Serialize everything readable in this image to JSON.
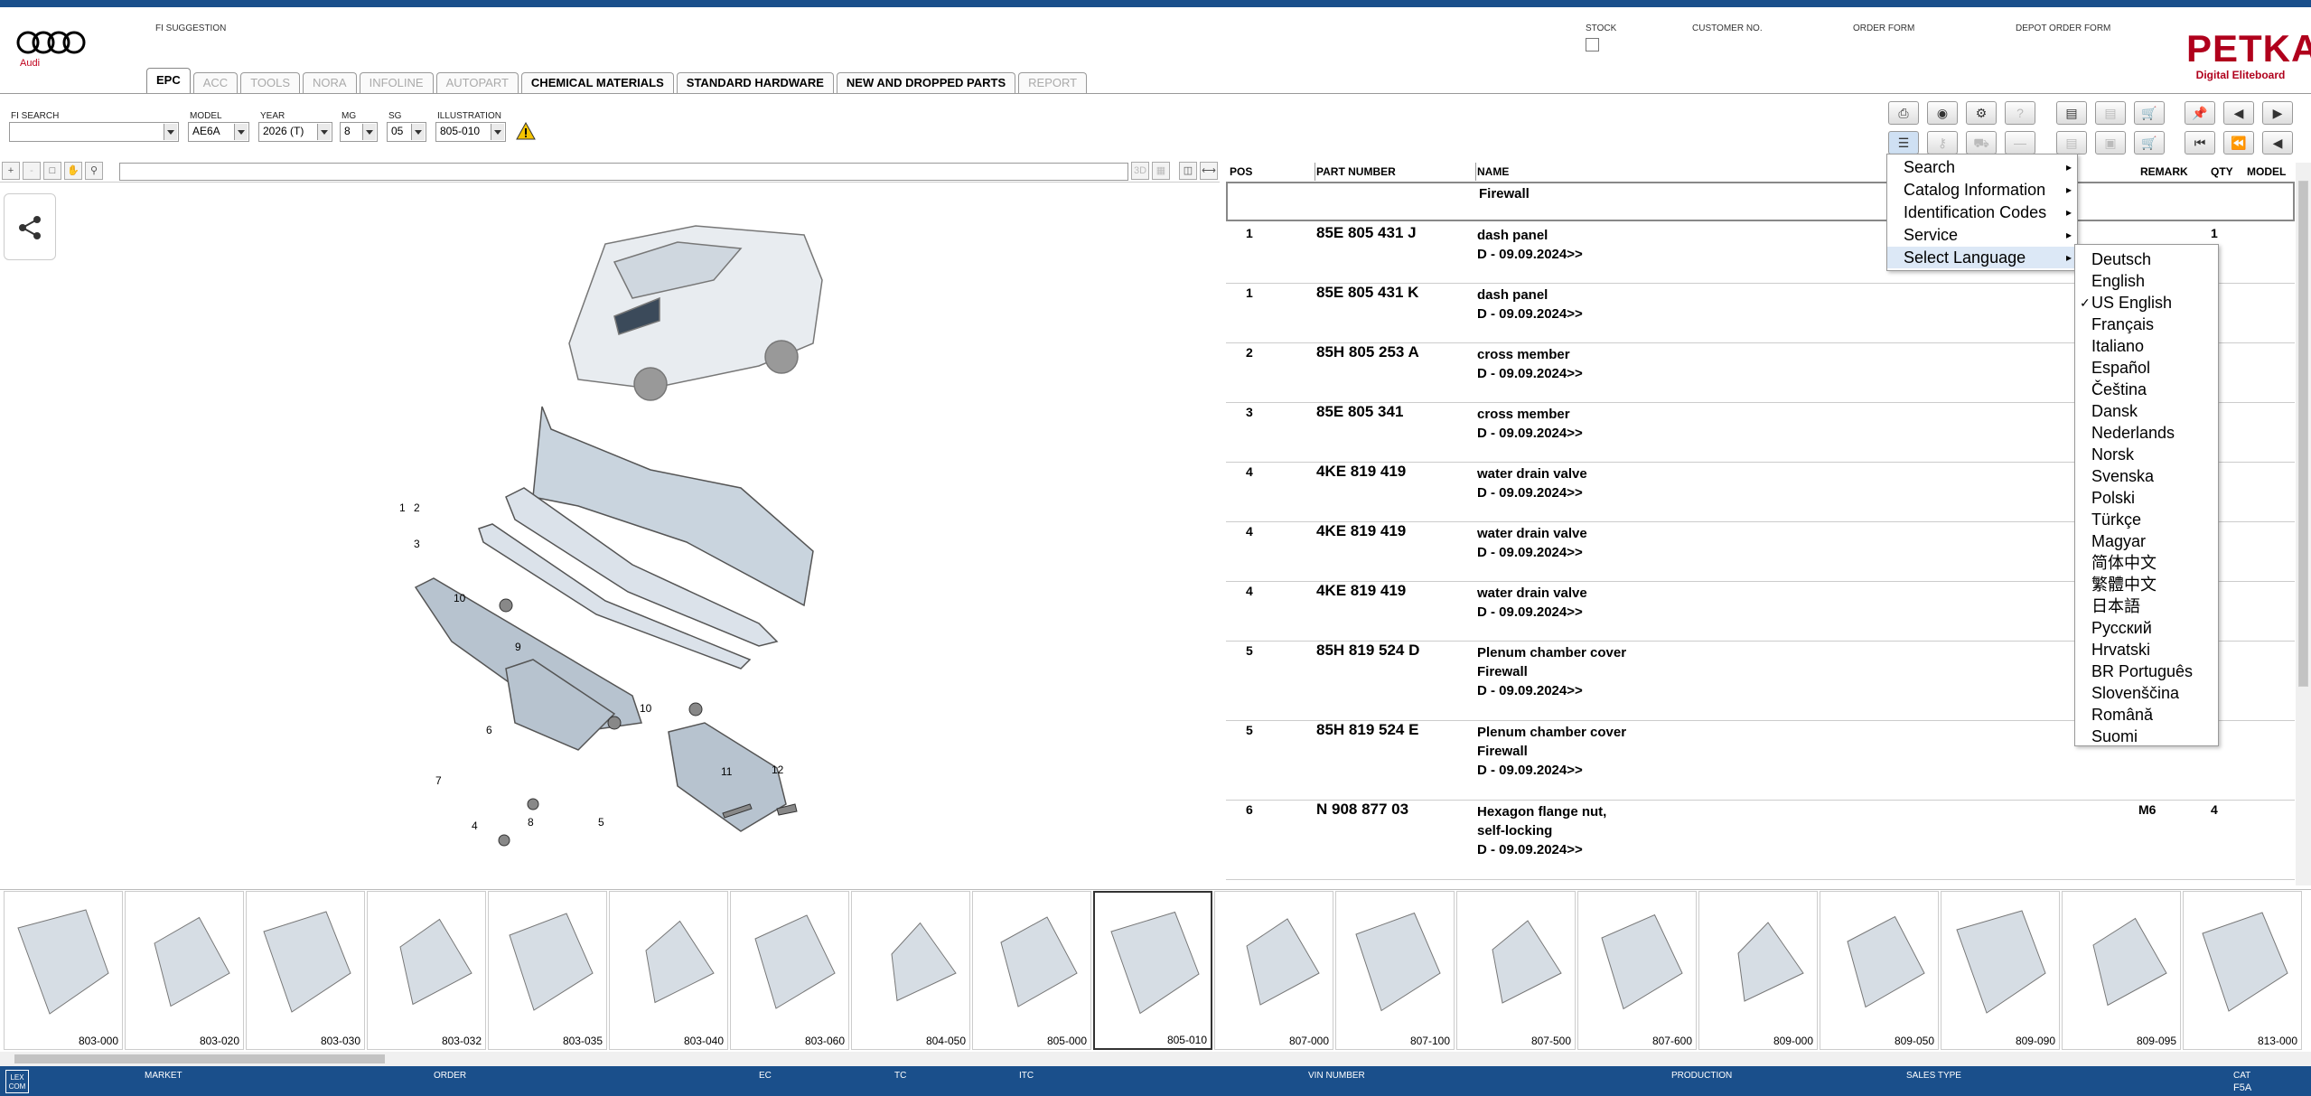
{
  "header": {
    "fi_suggestion": "FI SUGGESTION",
    "brand": "Audi",
    "stock": "STOCK",
    "customer_no": "CUSTOMER NO.",
    "order_form": "ORDER FORM",
    "depot_order_form": "DEPOT ORDER FORM",
    "petka_title": "PETKA",
    "petka_sub": "Digital Eliteboard"
  },
  "tabs": [
    {
      "label": "EPC",
      "state": "active"
    },
    {
      "label": "ACC",
      "state": "disabled"
    },
    {
      "label": "TOOLS",
      "state": "disabled"
    },
    {
      "label": "NORA",
      "state": "disabled"
    },
    {
      "label": "INFOLINE",
      "state": "disabled"
    },
    {
      "label": "AUTOPART",
      "state": "disabled"
    },
    {
      "label": "CHEMICAL MATERIALS",
      "state": "enabled"
    },
    {
      "label": "STANDARD HARDWARE",
      "state": "enabled"
    },
    {
      "label": "NEW AND DROPPED PARTS",
      "state": "enabled"
    },
    {
      "label": "REPORT",
      "state": "disabled"
    }
  ],
  "filters": {
    "fi_search_label": "FI SEARCH",
    "fi_search_value": "",
    "model_label": "MODEL",
    "model_value": "AE6A",
    "year_label": "YEAR",
    "year_value": "2026 (T)",
    "mg_label": "MG",
    "mg_value": "8",
    "sg_label": "SG",
    "sg_value": "05",
    "illustration_label": "ILLUSTRATION",
    "illustration_value": "805-010"
  },
  "table": {
    "headers": {
      "pos": "POS",
      "part_number": "PART NUMBER",
      "name": "NAME",
      "remark": "REMARK",
      "qty": "QTY",
      "model": "MODEL"
    },
    "first_row_name": "Firewall",
    "rows": [
      {
        "pos": "1",
        "part": "85E 805 431 J",
        "name": [
          "dash panel",
          "D - 09.09.2024>>"
        ],
        "remark": "",
        "qty": "1"
      },
      {
        "pos": "1",
        "part": "85E 805 431 K",
        "name": [
          "dash panel",
          "D - 09.09.2024>>"
        ],
        "remark": "",
        "qty": ""
      },
      {
        "pos": "2",
        "part": "85H 805 253 A",
        "name": [
          "cross member",
          "D - 09.09.2024>>"
        ],
        "remark": "",
        "qty": ""
      },
      {
        "pos": "3",
        "part": "85E 805 341",
        "name": [
          "cross member",
          "D - 09.09.2024>>"
        ],
        "remark": "",
        "qty": ""
      },
      {
        "pos": "4",
        "part": "4KE 819 419",
        "name": [
          "water drain valve",
          "D - 09.09.2024>>"
        ],
        "remark": "",
        "qty": ""
      },
      {
        "pos": "4",
        "part": "4KE 819 419",
        "name": [
          "water drain valve",
          "D - 09.09.2024>>"
        ],
        "remark": "",
        "qty": ""
      },
      {
        "pos": "4",
        "part": "4KE 819 419",
        "name": [
          "water drain valve",
          "D - 09.09.2024>>"
        ],
        "remark": "",
        "qty": ""
      },
      {
        "pos": "5",
        "part": "85H 819 524 D",
        "name": [
          "Plenum chamber cover",
          "Firewall",
          "D - 09.09.2024>>"
        ],
        "remark": "",
        "qty": ""
      },
      {
        "pos": "5",
        "part": "85H 819 524 E",
        "name": [
          "Plenum chamber cover",
          "Firewall",
          "D - 09.09.2024>>"
        ],
        "remark": "",
        "qty": ""
      },
      {
        "pos": "6",
        "part": "N   908 877 03",
        "name": [
          "Hexagon flange nut,",
          "self-locking",
          "D - 09.09.2024>>"
        ],
        "remark": "M6",
        "qty": "4"
      }
    ]
  },
  "context_menu": {
    "items": [
      {
        "label": "Search",
        "highlight": false
      },
      {
        "label": "Catalog Information",
        "highlight": false
      },
      {
        "label": "Identification Codes",
        "highlight": false
      },
      {
        "label": "Service",
        "highlight": false
      },
      {
        "label": "Select Language",
        "highlight": true
      }
    ]
  },
  "languages": [
    {
      "label": "Deutsch",
      "checked": false
    },
    {
      "label": "English",
      "checked": false
    },
    {
      "label": "US English",
      "checked": true
    },
    {
      "label": "Français",
      "checked": false
    },
    {
      "label": "Italiano",
      "checked": false
    },
    {
      "label": "Español",
      "checked": false
    },
    {
      "label": "Čeština",
      "checked": false
    },
    {
      "label": "Dansk",
      "checked": false
    },
    {
      "label": "Nederlands",
      "checked": false
    },
    {
      "label": "Norsk",
      "checked": false
    },
    {
      "label": "Svenska",
      "checked": false
    },
    {
      "label": "Polski",
      "checked": false
    },
    {
      "label": "Türkçe",
      "checked": false
    },
    {
      "label": "Magyar",
      "checked": false
    },
    {
      "label": "简体中文",
      "checked": false
    },
    {
      "label": "繁體中文",
      "checked": false
    },
    {
      "label": "日本語",
      "checked": false
    },
    {
      "label": "Русский",
      "checked": false
    },
    {
      "label": "Hrvatski",
      "checked": false
    },
    {
      "label": "BR Português",
      "checked": false
    },
    {
      "label": "Slovenščina",
      "checked": false
    },
    {
      "label": "Română",
      "checked": false
    },
    {
      "label": "Suomi",
      "checked": false
    }
  ],
  "thumbnails": [
    {
      "label": "803-000",
      "selected": false
    },
    {
      "label": "803-020",
      "selected": false
    },
    {
      "label": "803-030",
      "selected": false
    },
    {
      "label": "803-032",
      "selected": false
    },
    {
      "label": "803-035",
      "selected": false
    },
    {
      "label": "803-040",
      "selected": false
    },
    {
      "label": "803-060",
      "selected": false
    },
    {
      "label": "804-050",
      "selected": false
    },
    {
      "label": "805-000",
      "selected": false
    },
    {
      "label": "805-010",
      "selected": true
    },
    {
      "label": "807-000",
      "selected": false
    },
    {
      "label": "807-100",
      "selected": false
    },
    {
      "label": "807-500",
      "selected": false
    },
    {
      "label": "807-600",
      "selected": false
    },
    {
      "label": "809-000",
      "selected": false
    },
    {
      "label": "809-050",
      "selected": false
    },
    {
      "label": "809-090",
      "selected": false
    },
    {
      "label": "809-095",
      "selected": false
    },
    {
      "label": "813-000",
      "selected": false
    }
  ],
  "diagram_callouts": [
    "1",
    "2",
    "3",
    "10",
    "9",
    "6",
    "10",
    "7",
    "4",
    "8",
    "5",
    "11",
    "12"
  ],
  "status": {
    "market": "MARKET",
    "order": "ORDER",
    "ec": "EC",
    "tc": "TC",
    "itc": "ITC",
    "vin": "VIN NUMBER",
    "production": "PRODUCTION",
    "sales_type": "SALES TYPE",
    "cat_label": "CAT",
    "cat_value": "F5A",
    "lexcom": "LEX COM"
  },
  "colors": {
    "brand_blue": "#1a4f8b",
    "audi_red": "#c0001c",
    "petka_red": "#b0001c"
  }
}
